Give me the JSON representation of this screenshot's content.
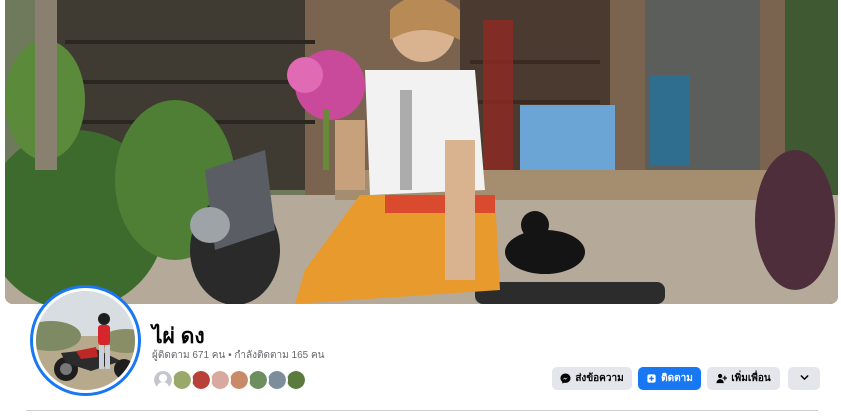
{
  "profile": {
    "name": "ไผ่ ดง",
    "stats": "ผู้ติดตาม 671 คน • กำลังติดตาม 165 คน"
  },
  "actions": {
    "message_label": "ส่งข้อความ",
    "follow_label": "ติดตาม",
    "add_friend_label": "เพิ่มเพื่อน",
    "more_icon": "chevron-down-icon"
  },
  "friends": [
    {
      "name": "friend-1",
      "color": "#c4c6cb"
    },
    {
      "name": "friend-2",
      "color": "#9aa86a"
    },
    {
      "name": "friend-3",
      "color": "#b8413a"
    },
    {
      "name": "friend-4",
      "color": "#d9a9a0"
    },
    {
      "name": "friend-5",
      "color": "#c98a6a"
    },
    {
      "name": "friend-6",
      "color": "#6d8f5f"
    },
    {
      "name": "friend-7",
      "color": "#7c8d9c"
    },
    {
      "name": "friend-8",
      "color": "#5a7a3e"
    }
  ],
  "colors": {
    "accent": "#1877f2",
    "button_gray": "#e4e6eb",
    "secondary_text": "#65676b"
  }
}
